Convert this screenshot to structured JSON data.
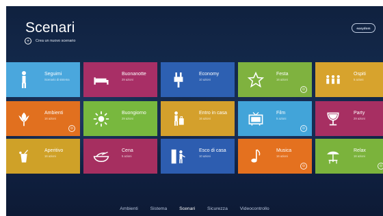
{
  "header": {
    "title": "Scenari",
    "new_label": "Crea un nuovo scenario",
    "brand": "easydom"
  },
  "tiles": [
    {
      "title": "Seguimi",
      "subtitle": "Scenario di sistema",
      "color": "#4aa7dd",
      "icon": "person-icon",
      "badge": ""
    },
    {
      "title": "Buonanotte",
      "subtitle": "29 azioni",
      "color": "#a82f66",
      "icon": "bed-icon",
      "badge": ""
    },
    {
      "title": "Economy",
      "subtitle": "10 azioni",
      "color": "#2d60b2",
      "icon": "plug-icon",
      "badge": ""
    },
    {
      "title": "Festa",
      "subtitle": "16 azioni",
      "color": "#7fb23f",
      "icon": "star-icon",
      "badge": "⊙"
    },
    {
      "title": "Ospiti",
      "subtitle": "5 azioni",
      "color": "#d7a32d",
      "icon": "people-icon",
      "badge": ""
    },
    {
      "title": "Ambienti",
      "subtitle": "16 azioni",
      "color": "#e1701f",
      "icon": "tulip-icon",
      "badge": "⊙"
    },
    {
      "title": "Buongiorno",
      "subtitle": "29 azioni",
      "color": "#78b83e",
      "icon": "sun-icon",
      "badge": ""
    },
    {
      "title": "Entro in casa",
      "subtitle": "16 azioni",
      "color": "#d4a02c",
      "icon": "luggage-icon",
      "badge": ""
    },
    {
      "title": "Film",
      "subtitle": "5 azioni",
      "color": "#42a4d9",
      "icon": "tv-icon",
      "badge": "⊙"
    },
    {
      "title": "Party",
      "subtitle": "29 azioni",
      "color": "#a72f62",
      "icon": "cocktail-icon",
      "badge": ""
    },
    {
      "title": "Aperitivo",
      "subtitle": "16 azioni",
      "color": "#cfa128",
      "icon": "drink-icon",
      "badge": ""
    },
    {
      "title": "Cena",
      "subtitle": "5 azioni",
      "color": "#a62f60",
      "icon": "bowl-icon",
      "badge": ""
    },
    {
      "title": "Esco di casa",
      "subtitle": "10 azioni",
      "color": "#2d5db0",
      "icon": "door-person-icon",
      "badge": ""
    },
    {
      "title": "Musica",
      "subtitle": "16 azioni",
      "color": "#e4711f",
      "icon": "music-note-icon",
      "badge": "⊙"
    },
    {
      "title": "Relax",
      "subtitle": "16 azioni",
      "color": "#7bb33c",
      "icon": "umbrella-chair-icon",
      "badge": "⊙"
    }
  ],
  "nav": {
    "items": [
      "Ambienti",
      "Sistema",
      "Scenari",
      "Sicurezza",
      "Videocontrollo"
    ],
    "active": "Scenari"
  }
}
